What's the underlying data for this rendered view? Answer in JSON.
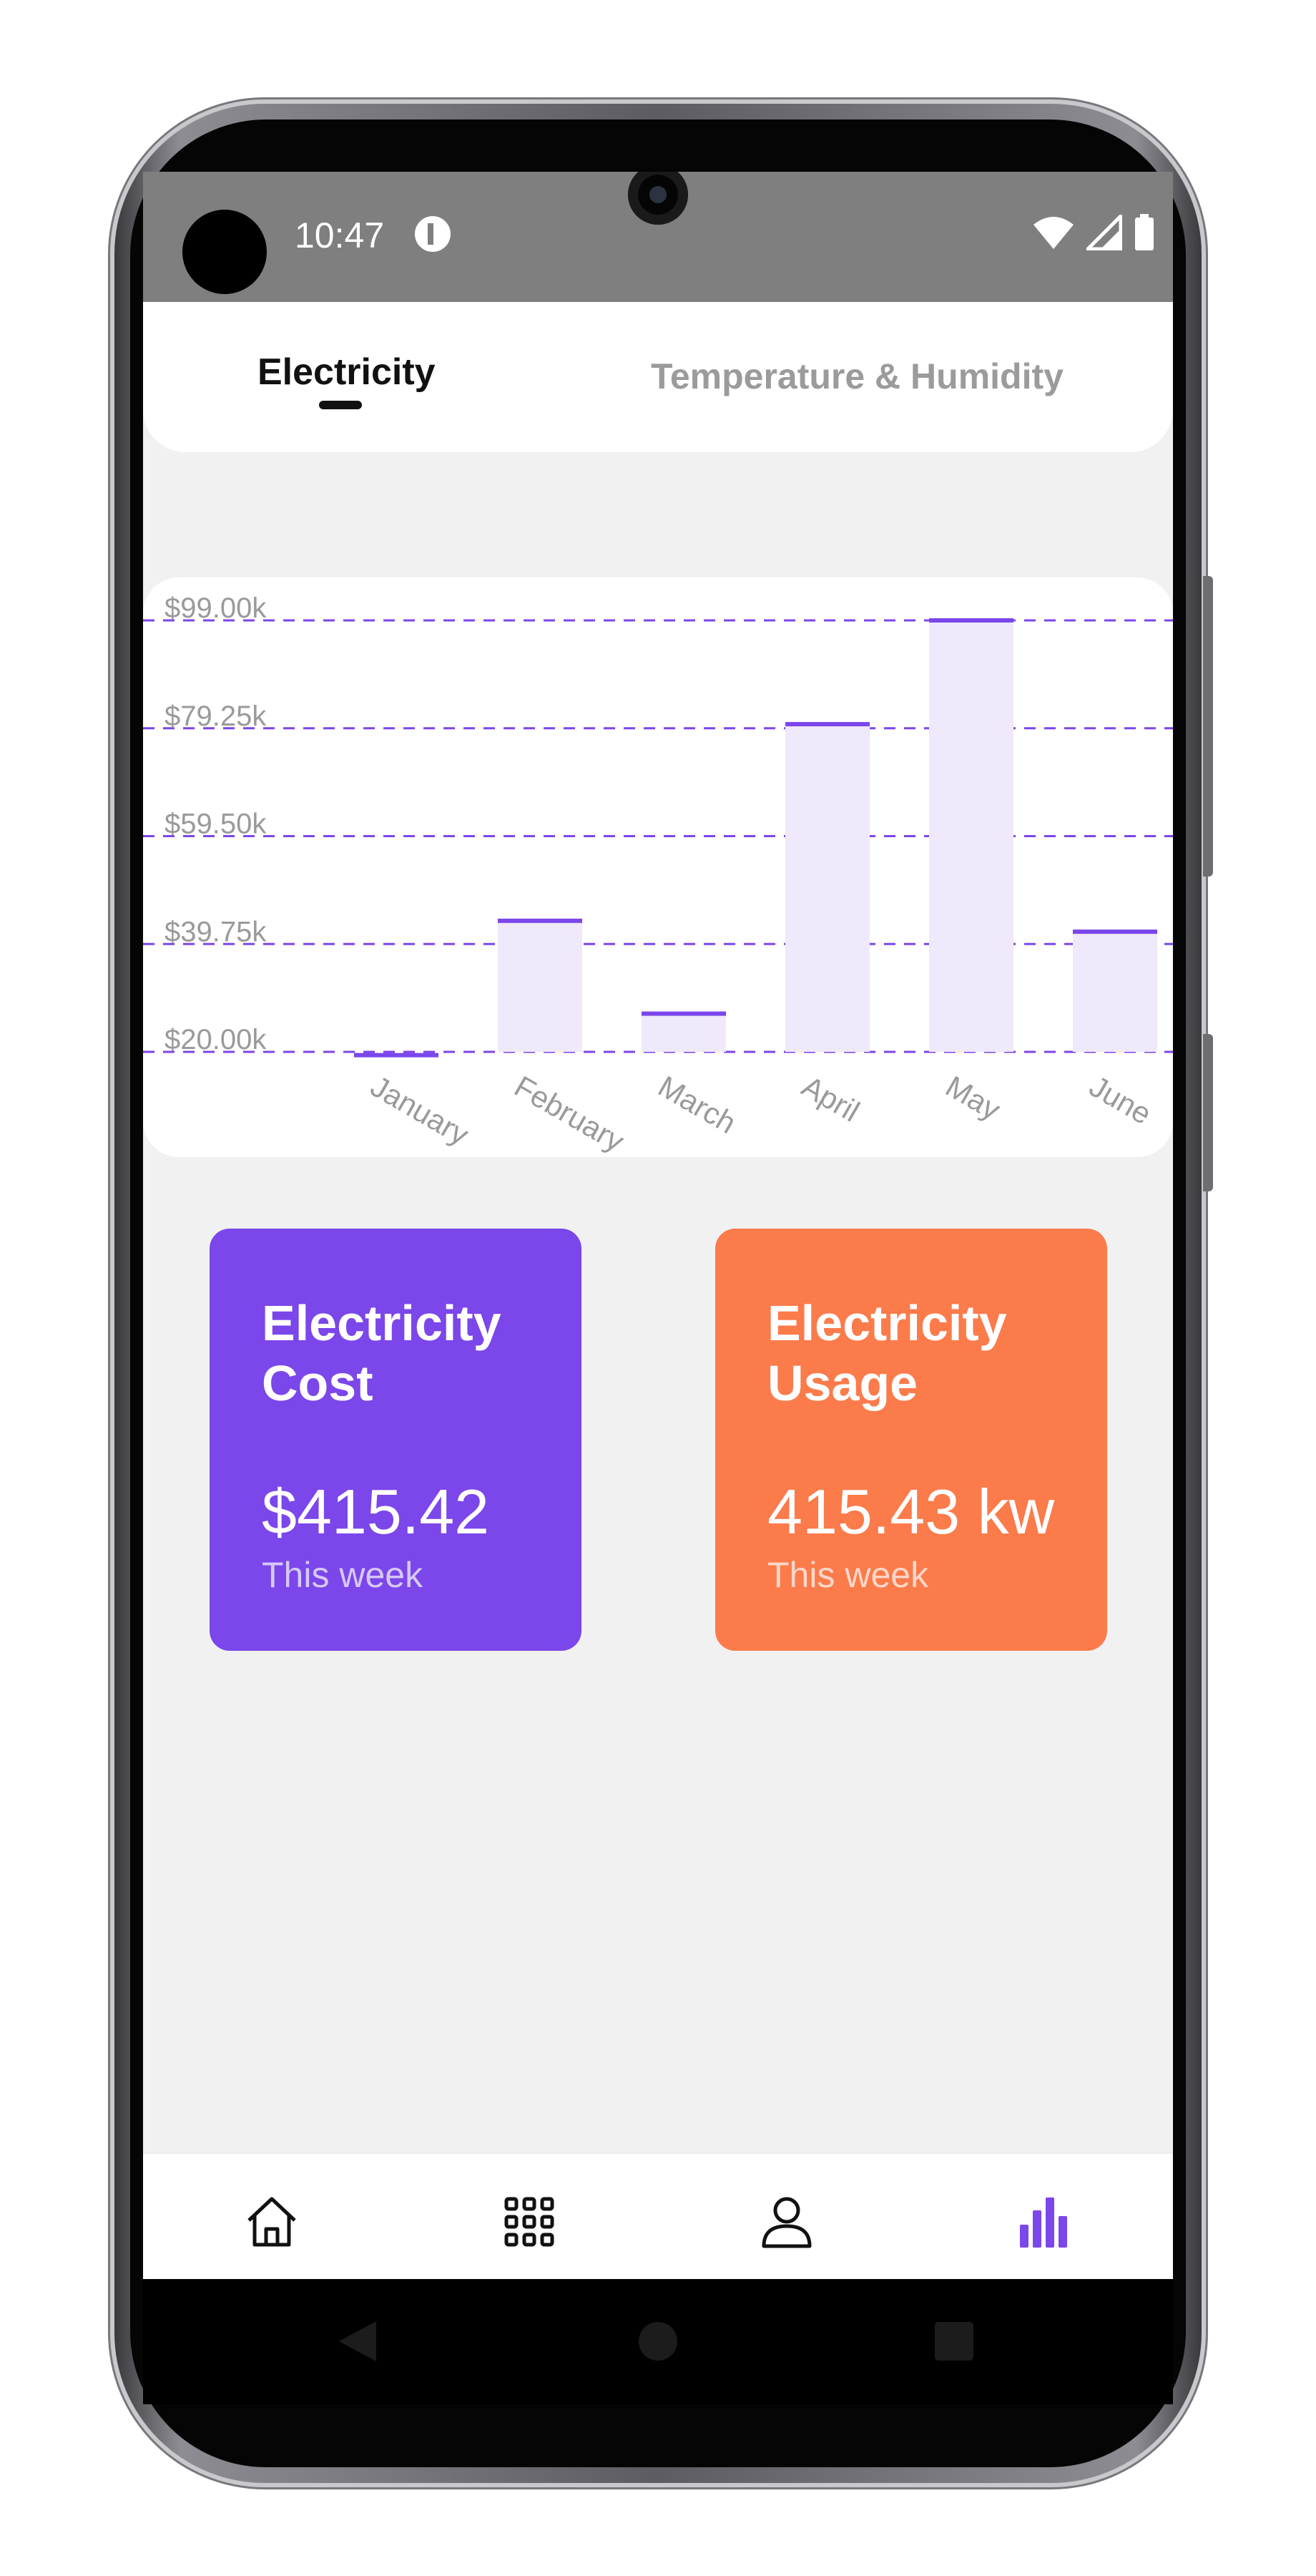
{
  "status_bar": {
    "time": "10:47",
    "icons": [
      "app-notification-icon",
      "wifi-icon",
      "signal-icon",
      "battery-icon"
    ]
  },
  "tabs": [
    {
      "label": "Electricity",
      "active": true
    },
    {
      "label": "Temperature & Humidity",
      "active": false
    }
  ],
  "chart_data": {
    "type": "bar",
    "categories": [
      "January",
      "February",
      "March",
      "April",
      "May",
      "June"
    ],
    "values": [
      19400,
      44000,
      27000,
      80000,
      99000,
      42000
    ],
    "yticks": [
      "$99.00k",
      "$79.25k",
      "$59.50k",
      "$39.75k",
      "$20.00k"
    ],
    "ylim": [
      20000,
      99000
    ],
    "grid": true,
    "bar_fill": "#efe9fb",
    "bar_top": "#7b46ea",
    "grid_color": "#7b46ea",
    "title": "",
    "xlabel": "",
    "ylabel": ""
  },
  "tiles": {
    "cost": {
      "title": "Electricity Cost",
      "value": "$415.42",
      "sub": "This week",
      "color": "#7b46ea"
    },
    "usage": {
      "title": "Electricity Usage",
      "value": "415.43 kw",
      "sub": "This week",
      "color": "#fb7b4b"
    }
  },
  "bottom_nav": [
    {
      "icon": "home-icon",
      "active": false
    },
    {
      "icon": "grid-icon",
      "active": false
    },
    {
      "icon": "profile-icon",
      "active": false
    },
    {
      "icon": "bar-chart-icon",
      "active": true
    }
  ],
  "system_nav": [
    "back-icon",
    "home-circle-icon",
    "recents-icon"
  ],
  "colors": {
    "accent": "#7b46ea",
    "orange": "#fb7b4b",
    "inactive": "#9b9b9b"
  }
}
